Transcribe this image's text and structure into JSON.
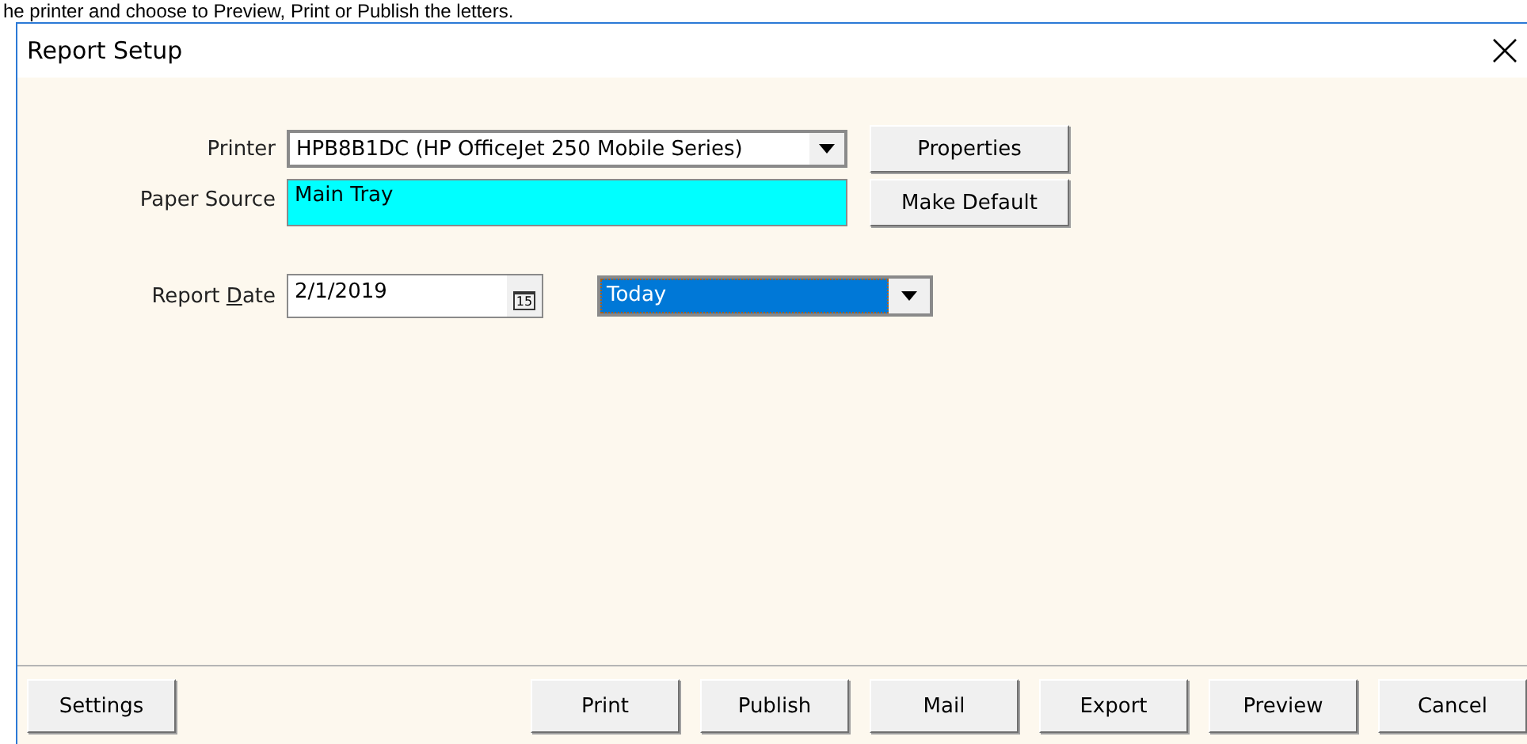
{
  "caption": "he printer and choose to Preview, Print or Publish the letters.",
  "window": {
    "title": "Report Setup"
  },
  "printer": {
    "label": "Printer",
    "value": "HPB8B1DC (HP OfficeJet 250 Mobile Series)",
    "button": "Properties"
  },
  "paper_source": {
    "label": "Paper Source",
    "value": "Main Tray",
    "button": "Make Default"
  },
  "report_date": {
    "label": {
      "before": "Report ",
      "access_key": "D",
      "after": "ate"
    },
    "value": "2/1/2019",
    "calendar_icon_text": "15",
    "range": {
      "value": "Today",
      "selected": true
    }
  },
  "buttons": [
    {
      "label": "Settings"
    },
    {
      "label": "Print"
    },
    {
      "label": "Publish"
    },
    {
      "label": "Mail"
    },
    {
      "label": "Export"
    },
    {
      "label": "Preview"
    },
    {
      "label": "Cancel"
    }
  ]
}
